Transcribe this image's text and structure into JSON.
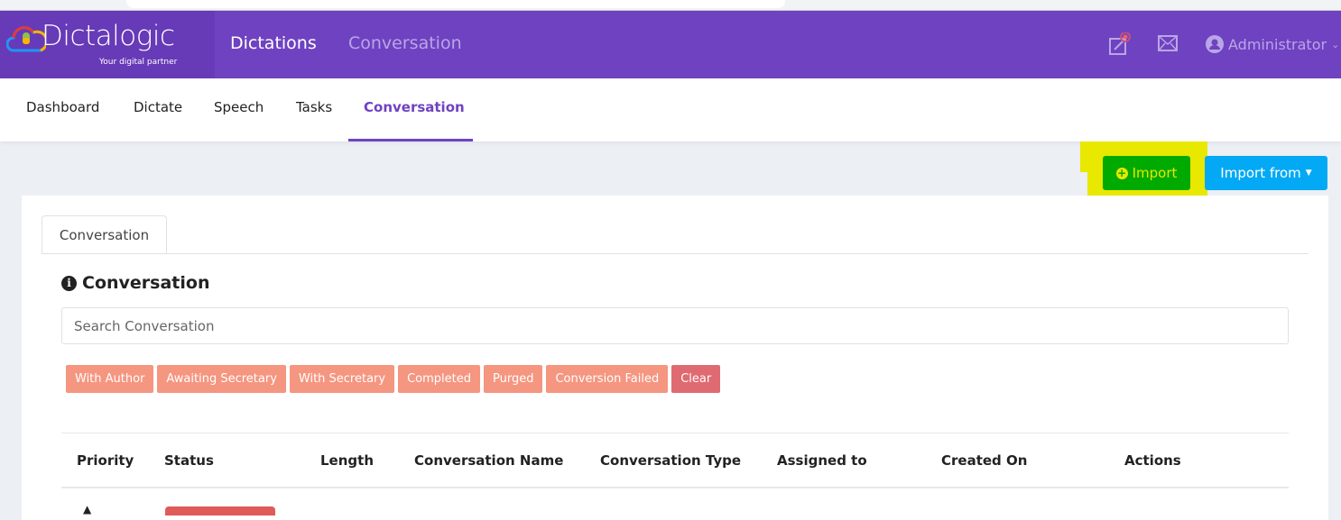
{
  "header": {
    "brand": "Dictalogic",
    "tagline": "Your digital partner",
    "nav": [
      "Dictations",
      "Conversation"
    ],
    "user": "Administrator"
  },
  "subnav": [
    "Dashboard",
    "Dictate",
    "Speech",
    "Tasks",
    "Conversation"
  ],
  "actions": {
    "import": "Import",
    "import_from": "Import from"
  },
  "card": {
    "tab": "Conversation",
    "title": "Conversation",
    "search_placeholder": "Search Conversation",
    "filters": [
      "With Author",
      "Awaiting Secretary",
      "With Secretary",
      "Completed",
      "Purged",
      "Conversion Failed",
      "Clear"
    ],
    "columns": [
      "Priority",
      "Status",
      "Length",
      "Conversation Name",
      "Conversation Type",
      "Assigned to",
      "Created On",
      "Actions"
    ]
  },
  "colors": {
    "brand": "#6f42c1",
    "import": "#00aa00",
    "import_from": "#03a9f4",
    "highlight": "#e8e800",
    "chip": "#f59680",
    "clear": "#e06a72"
  }
}
